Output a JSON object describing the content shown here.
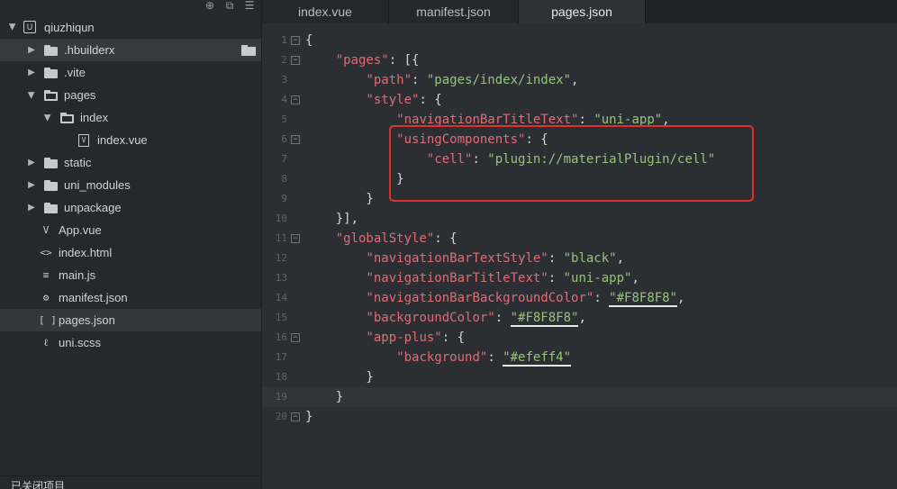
{
  "sidebar": {
    "toolbar": [
      "⊕",
      "⧉",
      "☰"
    ],
    "root": {
      "label": "qiuzhiqun",
      "icon": "U"
    },
    "items": [
      {
        "label": ".hbuilderx",
        "type": "folder",
        "indent": 1,
        "chevron": "right",
        "highlight": true
      },
      {
        "label": ".vite",
        "type": "folder",
        "indent": 1,
        "chevron": "right"
      },
      {
        "label": "pages",
        "type": "folder-open",
        "indent": 1,
        "chevron": "down"
      },
      {
        "label": "index",
        "type": "folder-open",
        "indent": 2,
        "chevron": "down"
      },
      {
        "label": "index.vue",
        "type": "file",
        "icon": "V",
        "indent": 3
      },
      {
        "label": "static",
        "type": "folder",
        "indent": 1,
        "chevron": "right"
      },
      {
        "label": "uni_modules",
        "type": "folder",
        "indent": 1,
        "chevron": "right"
      },
      {
        "label": "unpackage",
        "type": "folder",
        "indent": 1,
        "chevron": "right"
      },
      {
        "label": "App.vue",
        "type": "file",
        "icon": "V",
        "indent": 1
      },
      {
        "label": "index.html",
        "type": "file",
        "icon": "<>",
        "indent": 1
      },
      {
        "label": "main.js",
        "type": "file",
        "icon": "≡",
        "indent": 1
      },
      {
        "label": "manifest.json",
        "type": "file",
        "icon": "⚙",
        "indent": 1
      },
      {
        "label": "pages.json",
        "type": "file",
        "icon": "[ ]",
        "indent": 1,
        "selected": true
      },
      {
        "label": "uni.scss",
        "type": "file",
        "icon": "ℓ",
        "indent": 1
      }
    ],
    "bottom_label": "已关闭项目"
  },
  "tabs": [
    {
      "label": "index.vue",
      "active": false
    },
    {
      "label": "manifest.json",
      "active": false
    },
    {
      "label": "pages.json",
      "active": true
    }
  ],
  "editor": {
    "current_line": 19,
    "lines": [
      {
        "n": "1",
        "fold": "−",
        "tokens": [
          [
            "p",
            "{"
          ]
        ]
      },
      {
        "n": "2",
        "fold": "−",
        "tokens": [
          [
            "p",
            "    "
          ],
          [
            "k",
            "\"pages\""
          ],
          [
            "p",
            ": [{"
          ]
        ]
      },
      {
        "n": "3",
        "tokens": [
          [
            "p",
            "        "
          ],
          [
            "k",
            "\"path\""
          ],
          [
            "p",
            ": "
          ],
          [
            "s",
            "\"pages/index/index\""
          ],
          [
            "p",
            ","
          ]
        ]
      },
      {
        "n": "4",
        "fold": "−",
        "tokens": [
          [
            "p",
            "        "
          ],
          [
            "k",
            "\"style\""
          ],
          [
            "p",
            ": {"
          ]
        ]
      },
      {
        "n": "5",
        "tokens": [
          [
            "p",
            "            "
          ],
          [
            "k",
            "\"navigationBarTitleText\""
          ],
          [
            "p",
            ": "
          ],
          [
            "s",
            "\"uni-app\""
          ],
          [
            "p",
            ","
          ]
        ]
      },
      {
        "n": "6",
        "fold": "−",
        "tokens": [
          [
            "p",
            "            "
          ],
          [
            "k",
            "\"usingComponents\""
          ],
          [
            "p",
            ": {"
          ]
        ]
      },
      {
        "n": "7",
        "tokens": [
          [
            "p",
            "                "
          ],
          [
            "k",
            "\"cell\""
          ],
          [
            "p",
            ": "
          ],
          [
            "s",
            "\"plugin://materialPlugin/cell\""
          ]
        ]
      },
      {
        "n": "8",
        "tokens": [
          [
            "p",
            "            }"
          ]
        ]
      },
      {
        "n": "9",
        "tokens": [
          [
            "p",
            "        }"
          ]
        ]
      },
      {
        "n": "10",
        "tokens": [
          [
            "p",
            "    }],"
          ]
        ]
      },
      {
        "n": "11",
        "fold": "−",
        "tokens": [
          [
            "p",
            "    "
          ],
          [
            "k",
            "\"globalStyle\""
          ],
          [
            "p",
            ": {"
          ]
        ]
      },
      {
        "n": "12",
        "tokens": [
          [
            "p",
            "        "
          ],
          [
            "k",
            "\"navigationBarTextStyle\""
          ],
          [
            "p",
            ": "
          ],
          [
            "s",
            "\"black\""
          ],
          [
            "p",
            ","
          ]
        ]
      },
      {
        "n": "13",
        "tokens": [
          [
            "p",
            "        "
          ],
          [
            "k",
            "\"navigationBarTitleText\""
          ],
          [
            "p",
            ": "
          ],
          [
            "s",
            "\"uni-app\""
          ],
          [
            "p",
            ","
          ]
        ]
      },
      {
        "n": "14",
        "tokens": [
          [
            "p",
            "        "
          ],
          [
            "k",
            "\"navigationBarBackgroundColor\""
          ],
          [
            "p",
            ": "
          ],
          [
            "s",
            "\"#F8F8F8\"",
            "u"
          ],
          [
            "p",
            ","
          ]
        ]
      },
      {
        "n": "15",
        "tokens": [
          [
            "p",
            "        "
          ],
          [
            "k",
            "\"backgroundColor\""
          ],
          [
            "p",
            ": "
          ],
          [
            "s",
            "\"#F8F8F8\"",
            "u"
          ],
          [
            "p",
            ","
          ]
        ]
      },
      {
        "n": "16",
        "fold": "−",
        "tokens": [
          [
            "p",
            "        "
          ],
          [
            "k",
            "\"app-plus\""
          ],
          [
            "p",
            ": {"
          ]
        ]
      },
      {
        "n": "17",
        "tokens": [
          [
            "p",
            "            "
          ],
          [
            "k",
            "\"background\""
          ],
          [
            "p",
            ": "
          ],
          [
            "s",
            "\"#efeff4\"",
            "u"
          ]
        ]
      },
      {
        "n": "18",
        "tokens": [
          [
            "p",
            "        }"
          ]
        ]
      },
      {
        "n": "19",
        "tokens": [
          [
            "p",
            "    }"
          ]
        ]
      },
      {
        "n": "20",
        "fold": "−",
        "tokens": [
          [
            "p",
            "}"
          ]
        ]
      }
    ]
  },
  "colors": {
    "key": "#e06c75",
    "string": "#98c379",
    "annotation": "#e0302a"
  }
}
